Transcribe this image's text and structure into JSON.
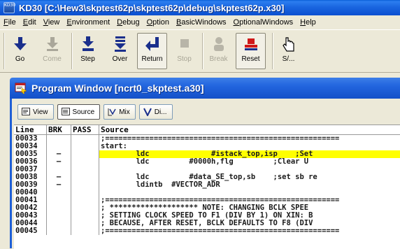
{
  "window": {
    "icon_text": "KD30",
    "title": "KD30 [C:\\Hew3\\skptest62p\\skptest62p\\debug\\skptest62p.x30]"
  },
  "menu": [
    "File",
    "Edit",
    "View",
    "Environment",
    "Debug",
    "Option",
    "BasicWindows",
    "OptionalWindows",
    "Help"
  ],
  "toolbar": {
    "go": "Go",
    "come": "Come",
    "step": "Step",
    "over": "Over",
    "return": "Return",
    "stop": "Stop",
    "break": "Break",
    "reset": "Reset",
    "s": "S/..."
  },
  "subwindow": {
    "title": "Program Window [ncrt0_skptest.a30]",
    "tabs": {
      "view": "View",
      "source": "Source",
      "mix": "Mix",
      "di": "Di..."
    }
  },
  "colors": {
    "highlight": "#FFFF00",
    "title_blue": "#0B4FD0"
  },
  "code": {
    "headers": {
      "line": "Line",
      "brk": "BRK",
      "pass": "PASS",
      "source": "Source"
    },
    "rows": [
      {
        "line": "00033",
        "brk": "",
        "source": ";====================================================="
      },
      {
        "line": "00034",
        "brk": "",
        "source": "start:"
      },
      {
        "line": "00035",
        "brk": "–",
        "source": "        ldc              #istack_top,isp    ;Set"
      },
      {
        "line": "00036",
        "brk": "–",
        "source": "        ldc         #0000h,flg         ;Clear U"
      },
      {
        "line": "00037",
        "brk": "",
        "source": ""
      },
      {
        "line": "00038",
        "brk": "–",
        "source": "        ldc         #data_SE_top,sb    ;set sb re"
      },
      {
        "line": "00039",
        "brk": "–",
        "source": "        ldintb  #VECTOR_ADR"
      },
      {
        "line": "00040",
        "brk": "",
        "source": ""
      },
      {
        "line": "00041",
        "brk": "",
        "source": ";====================================================="
      },
      {
        "line": "00042",
        "brk": "",
        "source": "; ******************** NOTE: CHANGING BCLK SPEE"
      },
      {
        "line": "00043",
        "brk": "",
        "source": "; SETTING CLOCK SPEED TO F1 (DIV BY 1) ON XIN: B"
      },
      {
        "line": "00044",
        "brk": "",
        "source": "; BECAUSE, AFTER RESET, BCLK DEFAULTS TO F8 (DIV"
      },
      {
        "line": "00045",
        "brk": "",
        "source": ";====================================================="
      }
    ]
  }
}
